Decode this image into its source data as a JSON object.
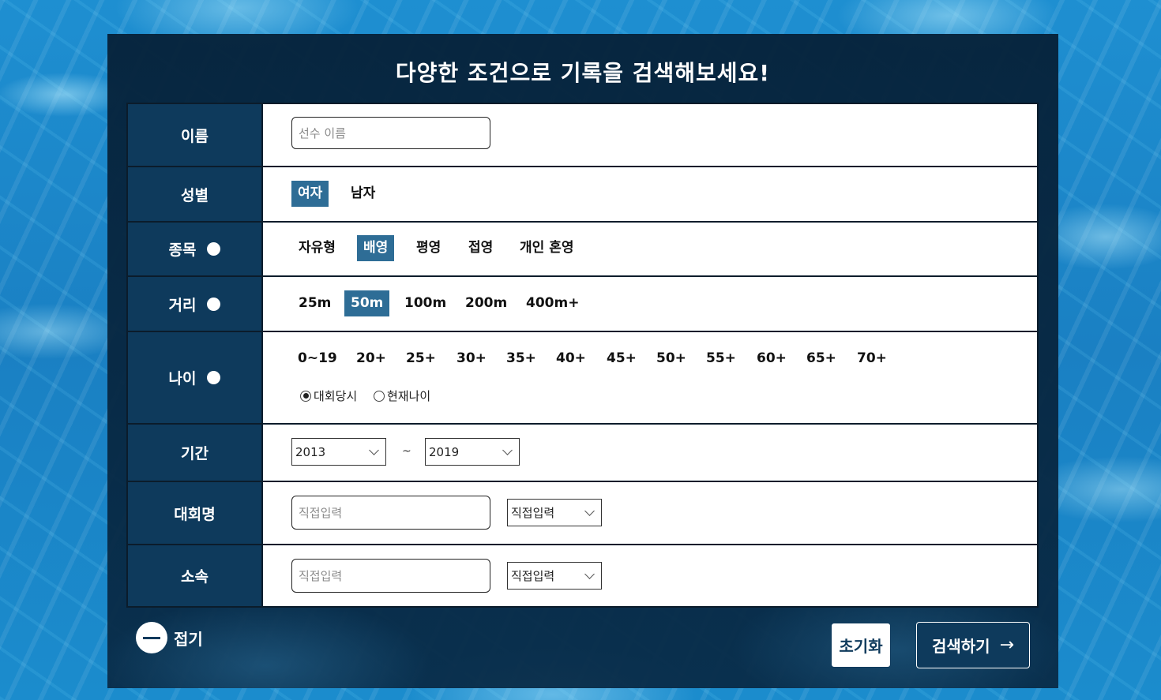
{
  "title": "다양한 조건으로 기록을 검색해보세요!",
  "name": {
    "label": "이름",
    "placeholder": "선수 이름"
  },
  "gender": {
    "label": "성별",
    "options": [
      "여자",
      "남자"
    ],
    "selected": "여자"
  },
  "stroke": {
    "label": "종목",
    "options": [
      "자유형",
      "배영",
      "평영",
      "접영",
      "개인 혼영"
    ],
    "selected": "배영"
  },
  "distance": {
    "label": "거리",
    "options": [
      "25m",
      "50m",
      "100m",
      "200m",
      "400m+"
    ],
    "selected": "50m"
  },
  "age": {
    "label": "나이",
    "options": [
      "0~19",
      "20+",
      "25+",
      "30+",
      "35+",
      "40+",
      "45+",
      "50+",
      "55+",
      "60+",
      "65+",
      "70+"
    ],
    "mode_options": [
      "대회당시",
      "현재나이"
    ],
    "mode_selected": "대회당시"
  },
  "period": {
    "label": "기간",
    "from": "2013",
    "separator": "~",
    "to": "2019"
  },
  "competition": {
    "label": "대회명",
    "placeholder": "직접입력",
    "select_value": "직접입력"
  },
  "affiliation": {
    "label": "소속",
    "placeholder": "직접입력",
    "select_value": "직접입력"
  },
  "fold_label": "접기",
  "reset_label": "초기화",
  "search_label": "검색하기",
  "search_arrow": "→",
  "colors": {
    "panel": "#0b2a45",
    "label_bg": "#0e3a5c",
    "selected": "#2e6d96"
  }
}
